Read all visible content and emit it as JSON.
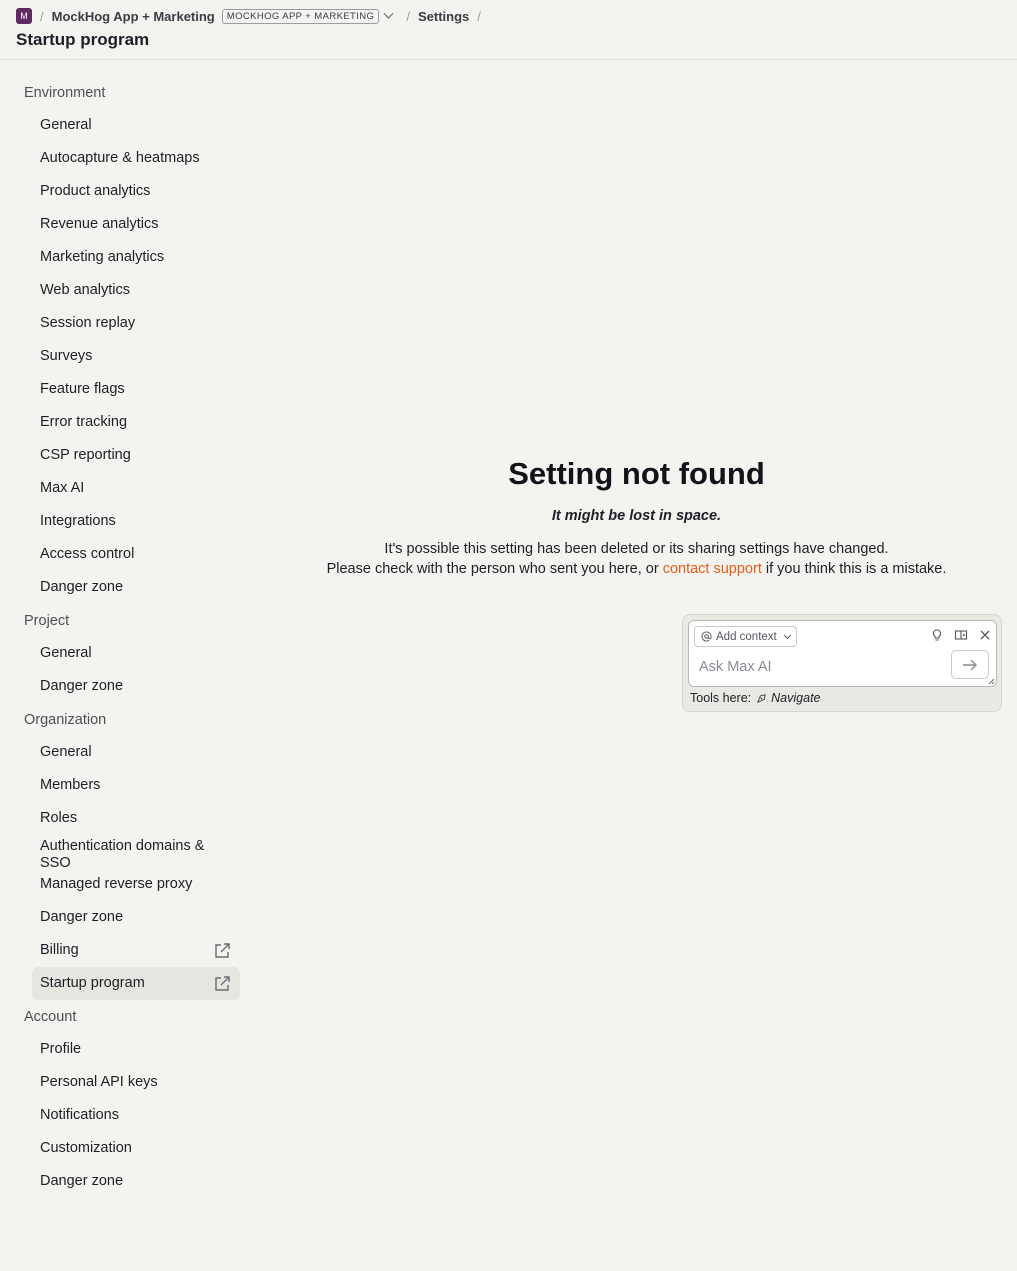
{
  "header": {
    "org_initial": "M",
    "project_name": "MockHog App + Marketing",
    "project_badge": "MOCKHOG APP + MARKETING",
    "breadcrumb_settings": "Settings",
    "separator": "/",
    "page_title": "Startup program"
  },
  "sidebar": {
    "sections": [
      {
        "title": "Environment",
        "items": [
          "General",
          "Autocapture & heatmaps",
          "Product analytics",
          "Revenue analytics",
          "Marketing analytics",
          "Web analytics",
          "Session replay",
          "Surveys",
          "Feature flags",
          "Error tracking",
          "CSP reporting",
          "Max AI",
          "Integrations",
          "Access control",
          "Danger zone"
        ]
      },
      {
        "title": "Project",
        "items": [
          "General",
          "Danger zone"
        ]
      },
      {
        "title": "Organization",
        "items": [
          "General",
          "Members",
          "Roles",
          "Authentication domains & SSO",
          "Managed reverse proxy",
          "Danger zone",
          "Billing",
          "Startup program"
        ]
      },
      {
        "title": "Account",
        "items": [
          "Profile",
          "Personal API keys",
          "Notifications",
          "Customization",
          "Danger zone"
        ]
      }
    ],
    "active_item": "Startup program"
  },
  "main": {
    "title": "Setting not found",
    "subtitle": "It might be lost in space.",
    "line1": "It's possible this setting has been deleted or its sharing settings have changed.",
    "line2_prefix": "Please check with the person who sent you here, or",
    "link_text": "contact support",
    "line2_suffix": "if you think this is a mistake."
  },
  "max_ai": {
    "add_context_label": "Add context",
    "placeholder": "Ask Max AI",
    "tools_label": "Tools here:",
    "tool_name": "Navigate"
  },
  "colors": {
    "background": "#f3f4ef",
    "link": "#eb5a1b",
    "active_item_bg": "#e5e6e0",
    "avatar": "#5f2a62"
  }
}
